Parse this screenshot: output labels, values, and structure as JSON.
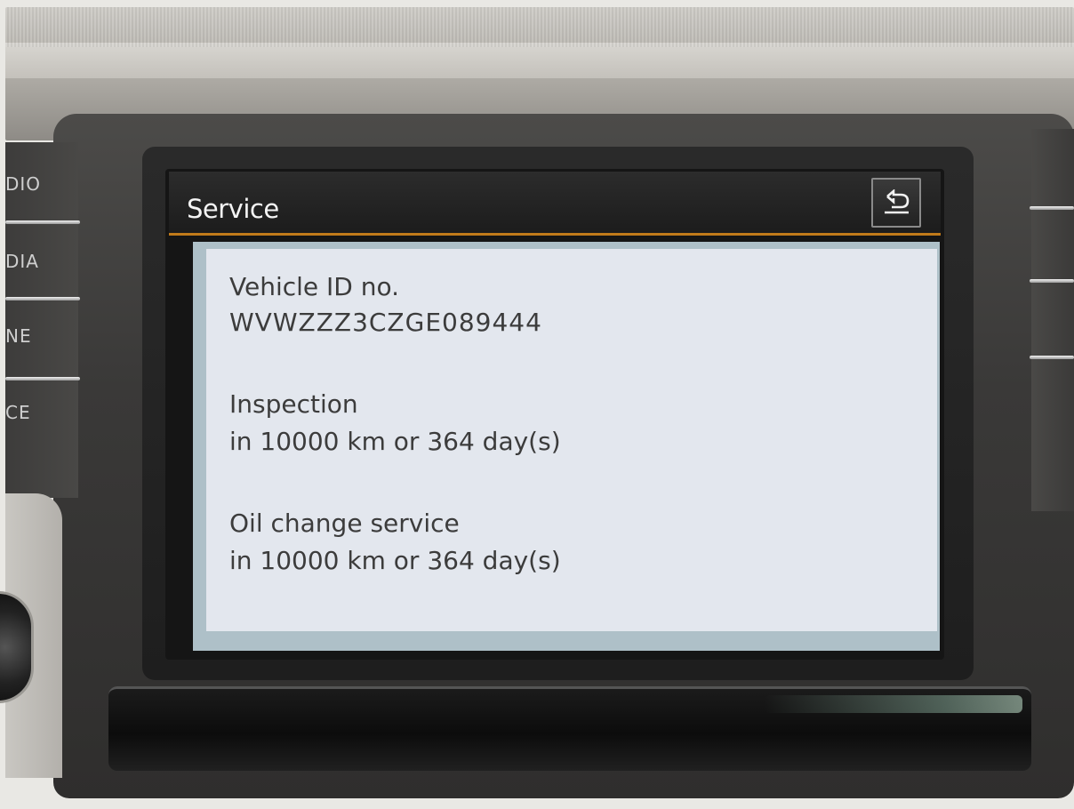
{
  "hardware": {
    "left_buttons": [
      "DIO",
      "DIA",
      "NE",
      "CE"
    ]
  },
  "header": {
    "title": "Service",
    "back_icon": "return-arrow-icon",
    "accent_color": "#c07a1a"
  },
  "service_info": {
    "vehicle_id_label": "Vehicle ID no.",
    "vehicle_id_value": "WVWZZZ3CZGE089444",
    "inspection_label": "Inspection",
    "inspection_value": "in 10000 km or 364 day(s)",
    "oil_change_label": "Oil change service",
    "oil_change_value": "in 10000 km or 364 day(s)"
  }
}
